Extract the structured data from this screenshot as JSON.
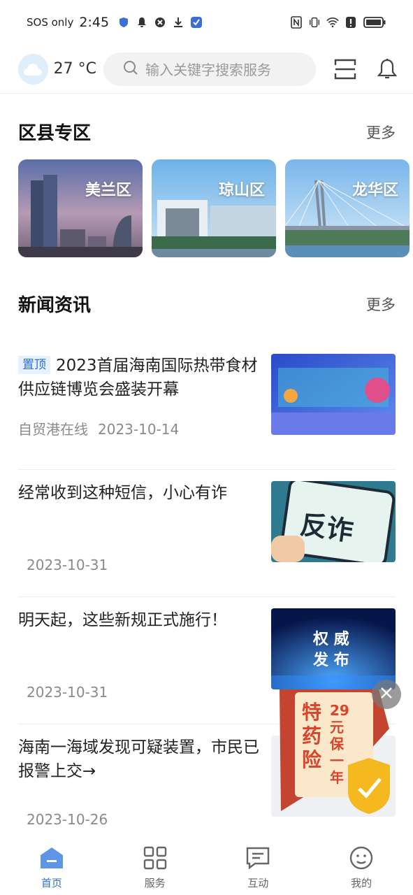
{
  "status_bar": {
    "carrier": "SOS only",
    "time": "2:45"
  },
  "top_bar": {
    "temperature": "27 °C",
    "search_placeholder": "输入关键字搜索服务",
    "weather_icon": "cloud-icon",
    "scan_icon": "scan-icon",
    "bell_icon": "bell-icon"
  },
  "districts_section": {
    "title": "区县专区",
    "more": "更多",
    "items": [
      {
        "label": "美兰区"
      },
      {
        "label": "琼山区"
      },
      {
        "label": "龙华区"
      }
    ]
  },
  "news_section": {
    "title": "新闻资讯",
    "more": "更多",
    "items": [
      {
        "badge": "置顶",
        "title": "2023首届海南国际热带食材供应链博览会盛装开幕",
        "source": "自贸港在线",
        "date": "2023-10-14"
      },
      {
        "title": "经常收到这种短信，小心有诈",
        "date": "2023-10-31",
        "thumb_text": "反诈"
      },
      {
        "title": "明天起，这些新规正式施行！",
        "date": "2023-10-31",
        "thumb_text_1": "权 威",
        "thumb_text_2": "发 布"
      },
      {
        "title": "海南一海域发现可疑装置，市民已报警上交→",
        "date": "2023-10-26"
      }
    ]
  },
  "float_ad": {
    "line1": "特药险",
    "line2": "29元保一年"
  },
  "tab_bar": {
    "active_color": "#2b6fd6",
    "tabs": [
      {
        "label": "首页",
        "icon": "home-icon",
        "active": true
      },
      {
        "label": "服务",
        "icon": "grid-icon",
        "active": false
      },
      {
        "label": "互动",
        "icon": "chat-icon",
        "active": false
      },
      {
        "label": "我的",
        "icon": "face-icon",
        "active": false
      }
    ]
  }
}
